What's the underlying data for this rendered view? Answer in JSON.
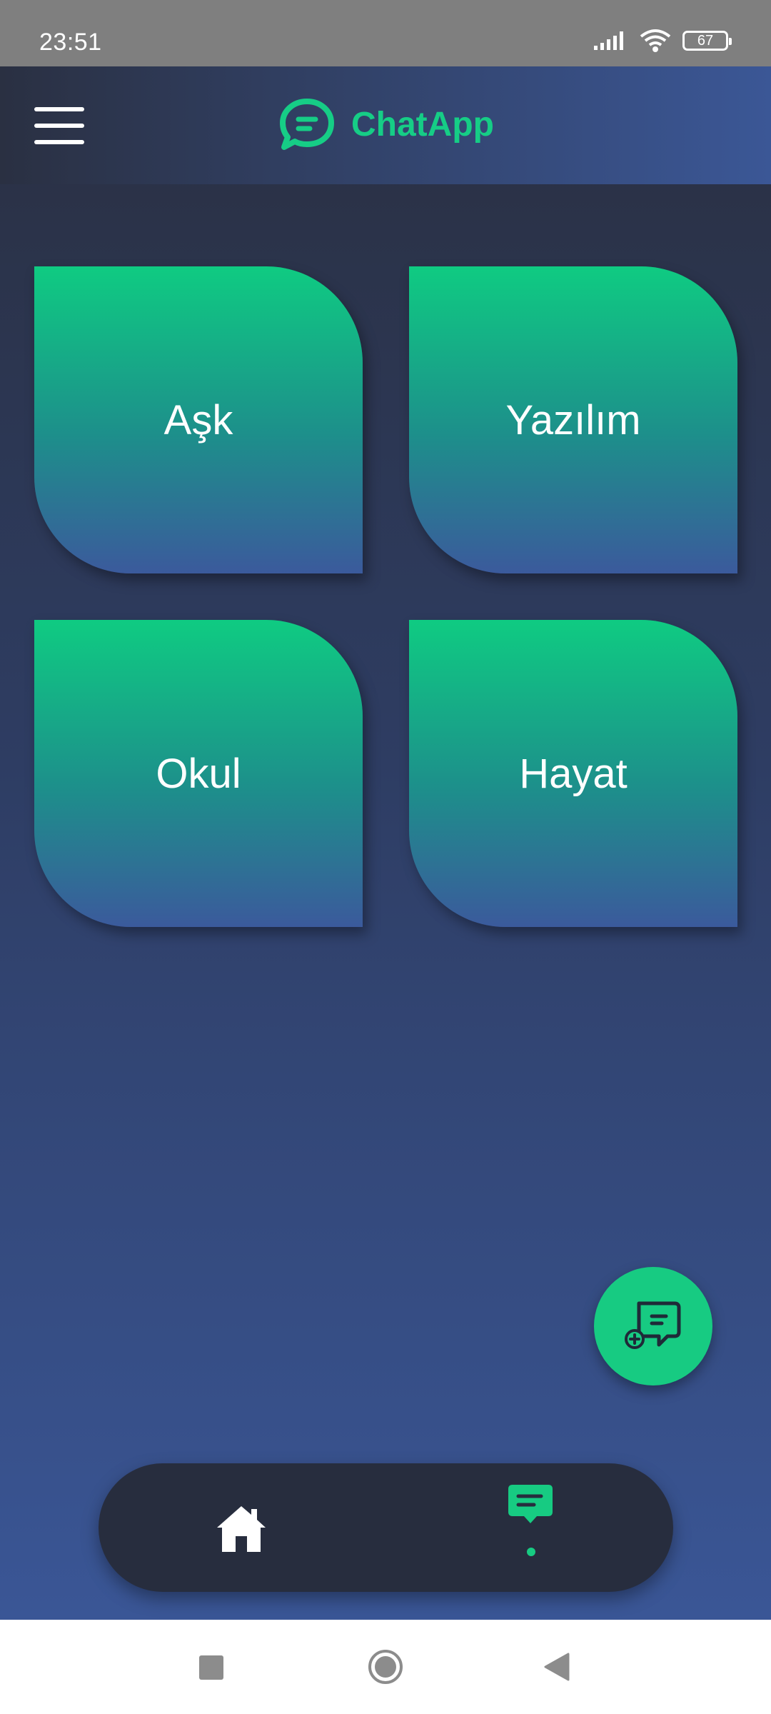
{
  "status_bar": {
    "time": "23:51",
    "battery": "67",
    "icons": [
      "signal-icon",
      "wifi-icon",
      "battery-icon"
    ]
  },
  "header": {
    "title": "ChatApp",
    "menu_icon": "hamburger-menu-icon",
    "logo_icon": "chat-bubble-icon"
  },
  "categories": [
    {
      "label": "Aşk"
    },
    {
      "label": "Yazılım"
    },
    {
      "label": "Okul"
    },
    {
      "label": "Hayat"
    }
  ],
  "fab": {
    "icon": "new-chat-icon"
  },
  "bottom_nav": {
    "items": [
      {
        "icon": "home-icon",
        "active": false
      },
      {
        "icon": "chat-icon",
        "active": true
      }
    ]
  },
  "system_nav": {
    "icons": [
      "recents-icon",
      "home-circle-icon",
      "back-icon"
    ]
  },
  "colors": {
    "accent": "#17cb82",
    "header_start": "#2a3042",
    "header_end": "#3b5796",
    "background_bottom": "#3a5696",
    "nav_bar": "#272d3e",
    "card_top": "#0fcb82",
    "card_bottom": "#3b5a9c"
  }
}
